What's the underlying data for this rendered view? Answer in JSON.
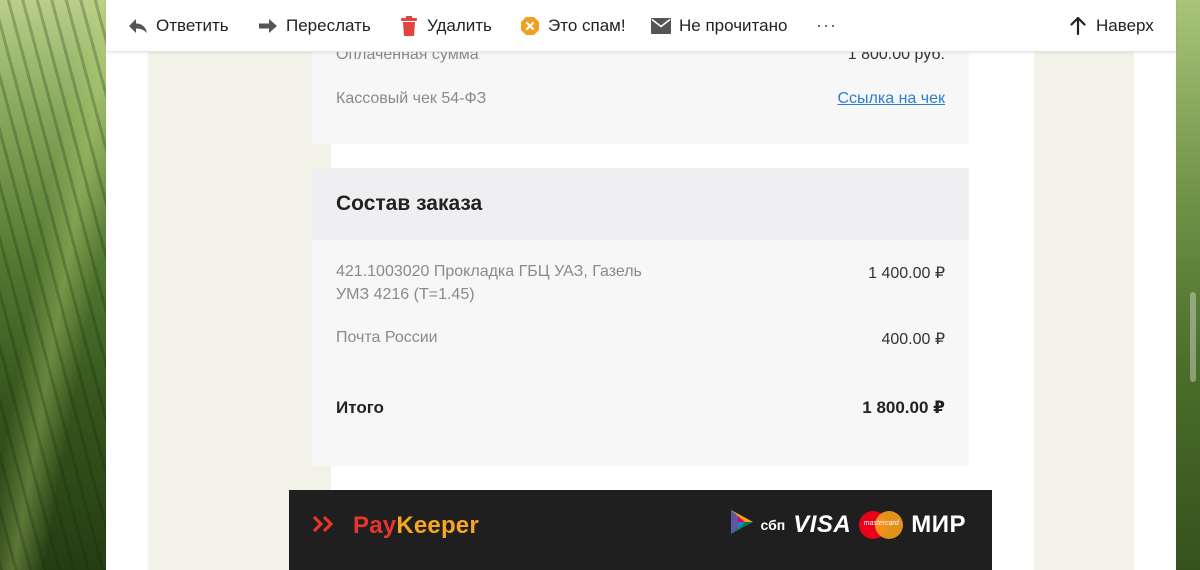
{
  "toolbar": {
    "reply_label": "Ответить",
    "forward_label": "Переслать",
    "delete_label": "Удалить",
    "spam_label": "Это спам!",
    "unread_label": "Не прочитано",
    "more_label": "···",
    "top_label": "Наверх"
  },
  "payment_info": {
    "paid_sum_label": "Оплаченная сумма",
    "paid_sum_value": "1 800.00 руб.",
    "receipt_label": "Кассовый чек 54-ФЗ",
    "receipt_link": "Ссылка на чек"
  },
  "order": {
    "title": "Состав заказа",
    "items": [
      {
        "name_line1": "421.1003020 Прокладка ГБЦ УАЗ, Газель",
        "name_line2": "УМЗ 4216 (Т=1.45)",
        "price": "1 400.00 ₽"
      },
      {
        "name_line1": "Почта России",
        "name_line2": "",
        "price": "400.00 ₽"
      }
    ],
    "total_label": "Итого",
    "total_value": "1 800.00 ₽"
  },
  "footer": {
    "brand_pay": "Pay",
    "brand_keeper": "Keeper",
    "sbp_label": "сбп",
    "visa_label": "VISA",
    "mastercard_label": "mastercard",
    "mir_label": "МИР"
  },
  "colors": {
    "link": "#2a7fd4",
    "delete_icon": "#e0463d",
    "spam_icon": "#f0a020",
    "brand_red": "#e8352b",
    "brand_orange": "#f5a623"
  }
}
